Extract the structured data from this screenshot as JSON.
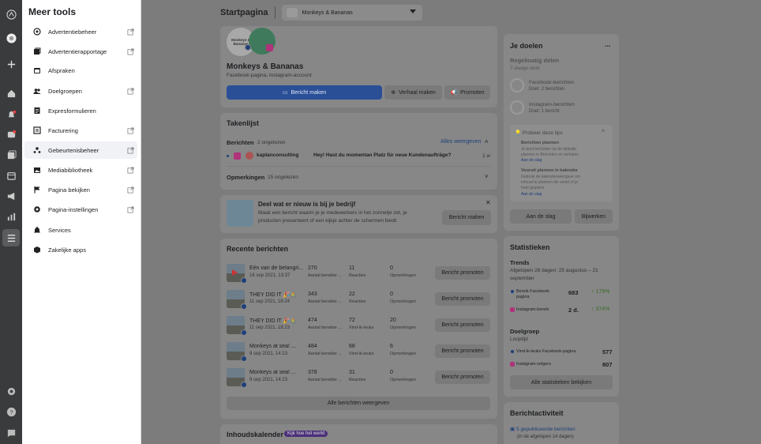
{
  "menu": {
    "title": "Meer tools",
    "items": [
      {
        "label": "Advertentiebeheer",
        "icon": "circle-target-icon",
        "ext": true
      },
      {
        "label": "Advertentierapportage",
        "icon": "report-icon",
        "ext": true
      },
      {
        "label": "Afspraken",
        "icon": "calendar-icon",
        "ext": false
      },
      {
        "label": "Doelgroepen",
        "icon": "people-icon",
        "ext": true
      },
      {
        "label": "Expresformulieren",
        "icon": "form-icon",
        "ext": false
      },
      {
        "label": "Facturering",
        "icon": "invoice-icon",
        "ext": true
      },
      {
        "label": "Gebeurtenisbeheer",
        "icon": "events-icon",
        "ext": true
      },
      {
        "label": "Mediabibliotheek",
        "icon": "media-icon",
        "ext": true
      },
      {
        "label": "Pagina bekijken",
        "icon": "flag-icon",
        "ext": true
      },
      {
        "label": "Pagina-instellingen",
        "icon": "gear-icon",
        "ext": true
      },
      {
        "label": "Services",
        "icon": "bell-services-icon",
        "ext": false
      },
      {
        "label": "Zakelijke apps",
        "icon": "box-icon",
        "ext": false
      }
    ]
  },
  "header": {
    "title": "Startpagina",
    "page_select": "Monkeys & Bananas"
  },
  "profile": {
    "logo_text": "Monkeys & Bananas",
    "name": "Monkeys & Bananas",
    "subtitle": "Facebook-pagina, Instagram-account",
    "create_post": "Bericht maken",
    "create_story": "Verhaal maken",
    "promote": "Promoten"
  },
  "tasks": {
    "title": "Takenlijst",
    "messages_label": "Berichten",
    "messages_count": "2 ongelezen",
    "show_all": "Alles weergeven",
    "msg_user": "kaplanconsulting",
    "msg_text": "Hey! Hast du momentan Platz für neue Kundenaufträge?",
    "msg_time": "1 w",
    "comments_label": "Opmerkingen",
    "comments_count": "15 ongelezen"
  },
  "share": {
    "title": "Deel wat er nieuw is bij je bedrijf",
    "text1": "Maak een bericht waarin je je medewerkers in het zonnetje zet, je",
    "text2": "producten presenteert of een kijkje achter de schermen biedt.",
    "button": "Bericht maken"
  },
  "recent": {
    "title": "Recente berichten",
    "promote_label": "Bericht promoten",
    "show_all": "Alle berichten weergeven",
    "posts": [
      {
        "title": "Eén van de belangri...",
        "date": "16 sep 2021, 13:37",
        "reach": "270",
        "reach_label": "Aantal bereikte ...",
        "m2": "11",
        "m2_label": "Reacties",
        "m3": "0",
        "m3_label": "Opmerkingen",
        "video": true
      },
      {
        "title": "THEY DID IT 🎉🚴",
        "date": "11 sep 2021, 18:24",
        "reach": "343",
        "reach_label": "Aantal bereikte ...",
        "m2": "22",
        "m2_label": "Reacties",
        "m3": "0",
        "m3_label": "Opmerkingen",
        "video": false
      },
      {
        "title": "THEY DID IT 🎉🚴",
        "date": "11 sep 2021, 18:23",
        "reach": "474",
        "reach_label": "Aantal bereikte ...",
        "m2": "72",
        "m2_label": "Vind-ik-leuks",
        "m3": "20",
        "m3_label": "Opmerkingen",
        "video": false
      },
      {
        "title": "Monkeys at sea! ...",
        "date": "9 sep 2021, 14:23",
        "reach": "484",
        "reach_label": "Aantal bereikte ...",
        "m2": "68",
        "m2_label": "Vind-ik-leuks",
        "m3": "6",
        "m3_label": "Opmerkingen",
        "video": false
      },
      {
        "title": "Monkeys at sea! ...",
        "date": "9 sep 2021, 14:23",
        "reach": "378",
        "reach_label": "Aantal bereikte ...",
        "m2": "31",
        "m2_label": "Reacties",
        "m3": "0",
        "m3_label": "Opmerkingen",
        "video": false
      }
    ]
  },
  "content_calendar": {
    "title": "Inhoudskalender",
    "badge": "Kijk hoe het werkt"
  },
  "goals": {
    "title": "Je doelen",
    "more": "...",
    "sub": "Regelmatig delen",
    "sub2": "7-daags doel",
    "items": [
      {
        "name": "Facebook-berichten",
        "goal": "Doel: 2 berichten"
      },
      {
        "name": "Instagram-berichten",
        "goal": "Doel: 1 bericht"
      }
    ],
    "tips_title": "Probeer deze tips",
    "tip1_title": "Berichten plannen",
    "tip1_text1": "Je kunt berichten op de tijdsstip",
    "tip1_text2": "plannen in Berichten en verhalen",
    "tip1_link": "Aan de slag",
    "tip2_title": "Vooruit plannen in kalender",
    "tip2_text1": "Gebruik de kalenderweergave om",
    "tip2_text2": "inhoud te plannen die werkt of je",
    "tip2_text3": "hebt gepland.",
    "tip2_link": "Aan de slag",
    "start": "Aan de slag",
    "edit": "Bijwerken"
  },
  "stats": {
    "title": "Statistieken",
    "trends": "Trends",
    "period": "Afgelopen 28 dagen: 25 augustus – 21",
    "period2": "september",
    "fb_reach_label": "Bereik Facebook-",
    "fb_reach_label2": "pagina",
    "fb_reach": "683",
    "fb_reach_change": "179%",
    "ig_reach_label": "Instagram-bereik",
    "ig_reach": "2 d.",
    "ig_reach_change": "374%",
    "audience": "Doelgroep",
    "lifetime": "Looptijd",
    "fb_likes_label": "Vind-ik-leuks Facebook-pagina",
    "fb_likes": "577",
    "ig_followers_label": "Instagram-volgers",
    "ig_followers": "807",
    "all": "Alle statistieken bekijken"
  },
  "activity": {
    "title": "Berichtactiviteit",
    "published": "5 gepubliceerde berichten",
    "period": "(in de afgelopen 14 dagen)"
  }
}
